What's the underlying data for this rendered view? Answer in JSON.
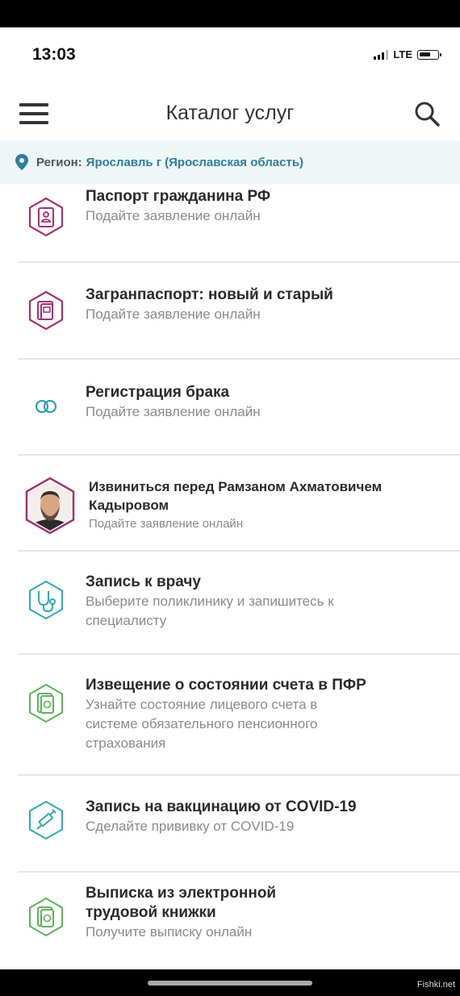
{
  "status_bar": {
    "time": "13:03",
    "network": "LTE"
  },
  "header": {
    "title": "Каталог услуг"
  },
  "region": {
    "label": "Регион:",
    "value": "Ярославль г (Ярославская область)"
  },
  "services": [
    {
      "name": "Паспорт гражданина РФ",
      "description": "Подайте заявление онлайн",
      "icon": "passport-icon"
    },
    {
      "name": "Загранпаспорт: новый и старый",
      "description": "Подайте заявление онлайн",
      "icon": "foreign-passport-icon"
    },
    {
      "name": "Регистрация брака",
      "description": "Подайте заявление онлайн",
      "icon": "rings-icon"
    },
    {
      "name_line1": "Извиниться перед Рамзаном Ахматовичем",
      "name_line2": "Кадыровом",
      "description": "Подайте заявление онлайн",
      "icon": "portrait-avatar"
    },
    {
      "name": "Запись к врачу",
      "description_line1": "Выберите поликлинику и запишитесь к",
      "description_line2": "специалисту",
      "icon": "stethoscope-icon"
    },
    {
      "name": "Извещение о состоянии счета в ПФР",
      "description_line1": "Узнайте состояние лицевого счета в",
      "description_line2": "системе обязательного пенсионного",
      "description_line3": "страхования",
      "icon": "pension-document-icon"
    },
    {
      "name": "Запись на вакцинацию от COVID-19",
      "description": "Сделайте прививку от COVID-19",
      "icon": "syringe-icon"
    },
    {
      "name_line1": "Выписка из электронной",
      "name_line2": "трудовой книжки",
      "description": "Получите выписку онлайн",
      "icon": "work-record-icon"
    }
  ],
  "watermark": "Fishki.net",
  "colors": {
    "accent": "#2d7f9c",
    "passport": "#a3336e",
    "rings": "#2fa0b8",
    "health": "#35a7b5",
    "pension": "#5eb35a"
  }
}
